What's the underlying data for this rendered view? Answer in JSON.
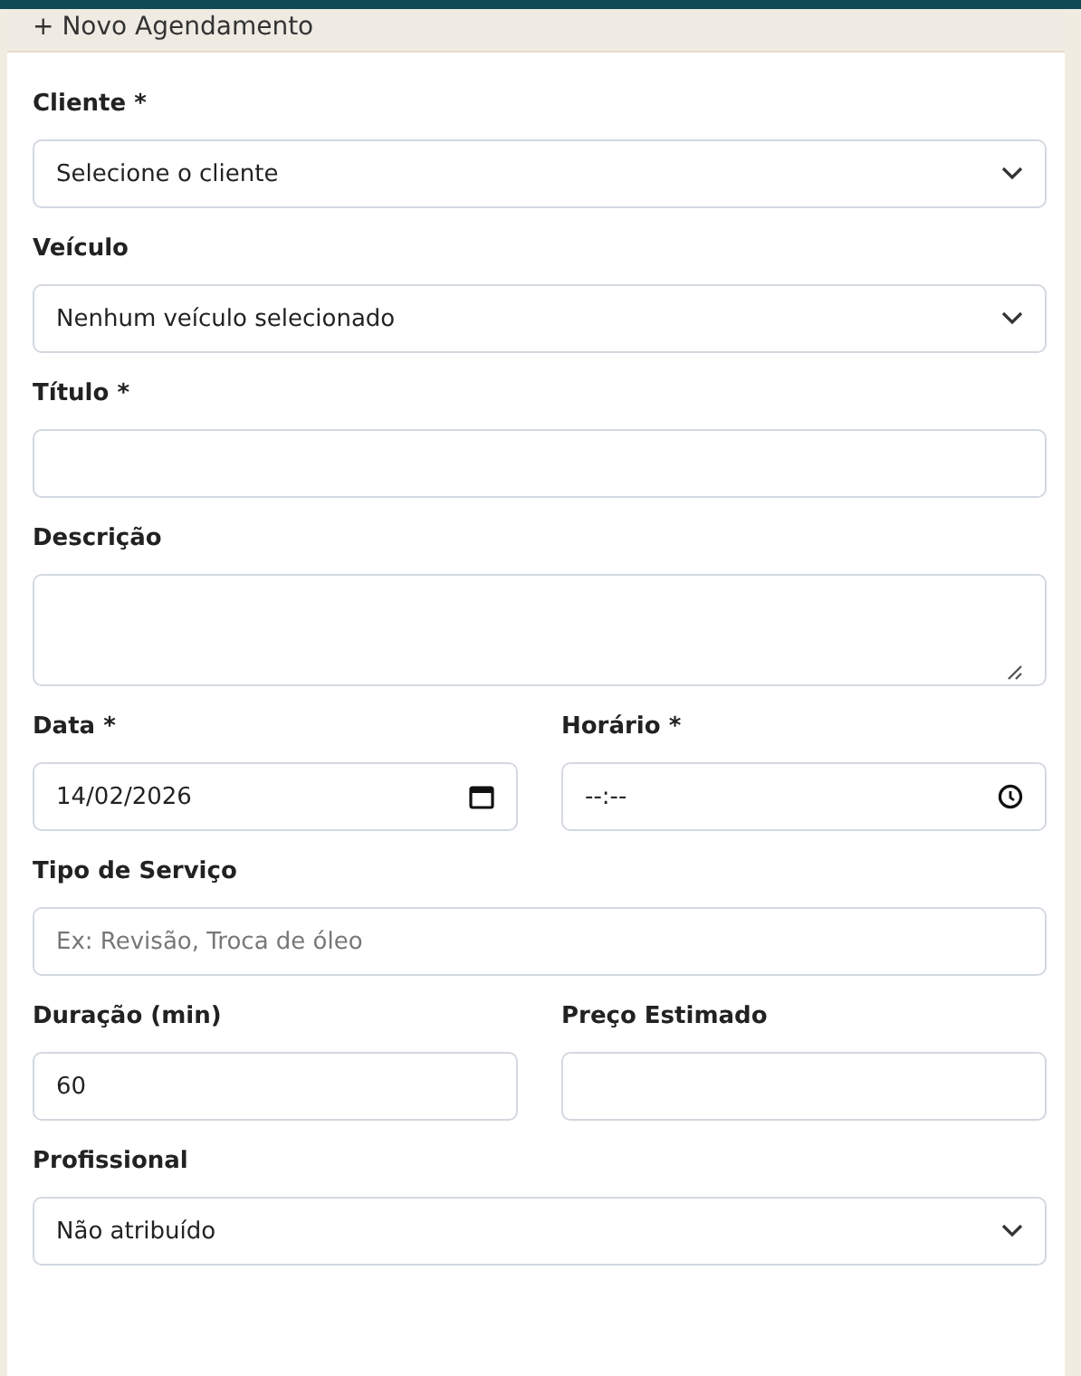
{
  "header": {
    "icon": "+",
    "title": "Novo Agendamento"
  },
  "rows": [
    {
      "fields": [
        {
          "label": "Cliente *",
          "kind": "select",
          "value": "Selecione o cliente"
        }
      ]
    },
    {
      "fields": [
        {
          "label": "Veículo",
          "kind": "select",
          "value": "Nenhum veículo selecionado"
        }
      ]
    },
    {
      "fields": [
        {
          "label": "Título *",
          "kind": "input"
        }
      ]
    },
    {
      "fields": [
        {
          "label": "Descrição",
          "kind": "textarea"
        }
      ]
    },
    {
      "fields": [
        {
          "label": "Data *",
          "kind": "date",
          "value": "14/02/2026"
        },
        {
          "label": "Horário *",
          "kind": "time",
          "value": "--:--"
        }
      ]
    },
    {
      "fields": [
        {
          "label": "Tipo de Serviço",
          "kind": "input",
          "placeholder": "Ex: Revisão, Troca de óleo"
        }
      ]
    },
    {
      "fields": [
        {
          "label": "Duração (min)",
          "kind": "input",
          "value": "60"
        },
        {
          "label": "Preço Estimado",
          "kind": "input"
        }
      ]
    },
    {
      "fields": [
        {
          "label": "Profissional",
          "kind": "select",
          "value": "Não atribuído"
        }
      ]
    }
  ]
}
